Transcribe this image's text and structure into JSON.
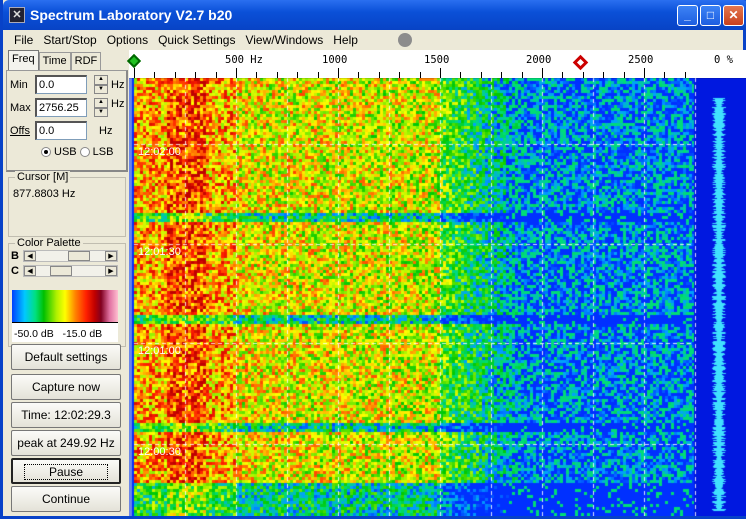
{
  "window": {
    "title": "Spectrum Laboratory V2.7 b20",
    "minimize": "_",
    "maximize": "□",
    "close": "✕"
  },
  "menu": [
    "File",
    "Start/Stop",
    "Options",
    "Quick Settings",
    "View/Windows",
    "Help"
  ],
  "tabs": [
    "Freq",
    "Time",
    "RDF"
  ],
  "freq": {
    "min_label": "Min",
    "min_value": "0.0",
    "max_label": "Max",
    "max_value": "2756.25",
    "offs_label": "Offs",
    "offs_value": "0.0",
    "unit": "Hz",
    "usb": "USB",
    "lsb": "LSB",
    "selected": "USB"
  },
  "cursor": {
    "title": "Cursor  [M]",
    "value": "877.8803 Hz"
  },
  "palette": {
    "title": "Color Palette",
    "b_label": "B",
    "c_label": "C",
    "b_position": 0.55,
    "c_position": 0.35,
    "min_db": "-50.0 dB",
    "max_db": "-15.0 dB"
  },
  "buttons": {
    "default": "Default settings",
    "capture": "Capture now",
    "time": "Time:  12:02:29.3",
    "peak": "peak at 249.92 Hz",
    "pause": "Pause",
    "continue": "Continue"
  },
  "axis": {
    "labels": [
      "500 Hz",
      "1000",
      "1500",
      "2000",
      "2500"
    ],
    "percent": "0 %",
    "min_hz": 0,
    "max_hz": 2756.25
  },
  "time_labels": [
    "12:02:00",
    "12:01:30",
    "12:01:00",
    "12:00:30"
  ],
  "colors": {
    "titlebar": "#0a50d8",
    "waterfall_bg": "#0030ff",
    "trace": "#40e0ff"
  }
}
